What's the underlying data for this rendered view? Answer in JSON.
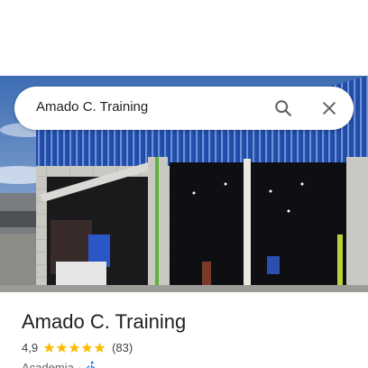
{
  "search": {
    "query": "Amado C. Training"
  },
  "place": {
    "name": "Amado C. Training",
    "rating": "4,9",
    "stars": 5,
    "review_count": "(83)",
    "category": "Academia",
    "separator": "·",
    "accessibility_icon": "wheelchair-accessible-icon"
  },
  "icons": {
    "search": "search-icon",
    "close": "close-icon",
    "star": "star-icon"
  },
  "colors": {
    "star": "#fbbc04",
    "accessibility": "#1a73e8",
    "text_primary": "#202124",
    "text_secondary": "#5f6368"
  }
}
